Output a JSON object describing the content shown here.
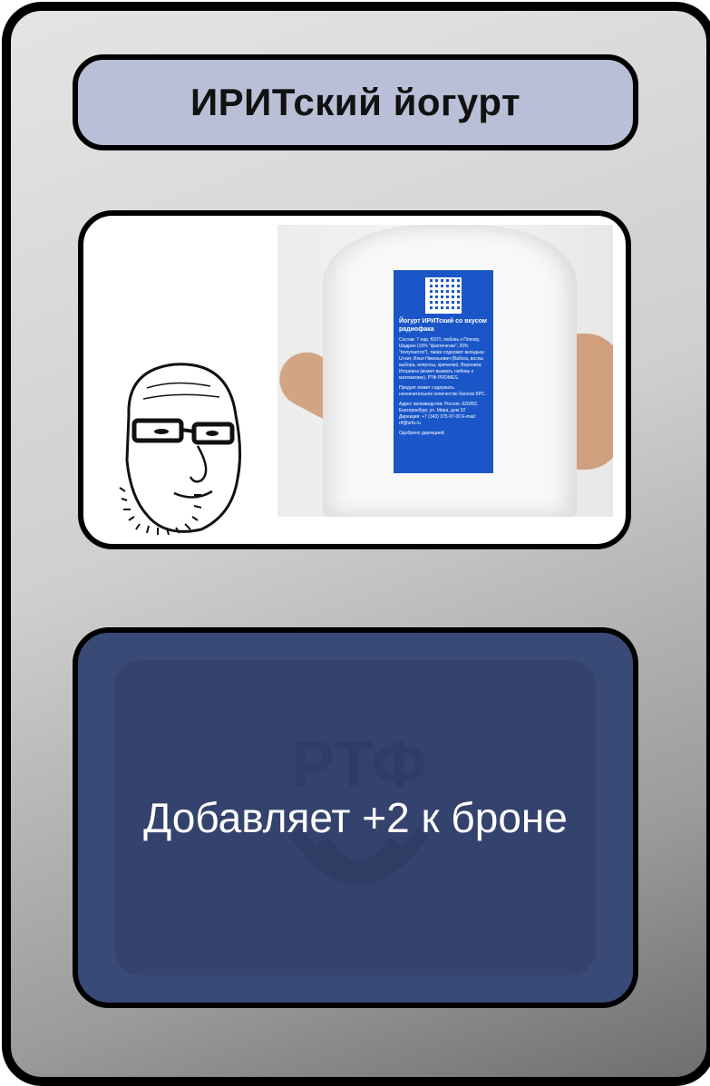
{
  "card": {
    "title": "ИРИТский йогурт",
    "effect": "Добавляет +2 к броне"
  },
  "shirt_label": {
    "heading": "Йогурт ИРИТский со вкусом радиофака",
    "composition": "Состав: 7 пар, ЮОТ, любовь к Попову, Шадрин (10% \"фактически\", 20% \"получается\"), также содержит вкладыш: Ui-кит, Илья Никоньевич (Вабога, воспы выбора, вопросы, кричалки), Вероника Игоревна (может вызвать любовь к математике), РТФ PROMES.",
    "note": "Продукт может содержать незначительное количество баллов БРС.",
    "address": "Адрес производства: Россия, 620002, Екатеринбург, ул. Мира, дом 32 Дирекция: +7 (343) 375-97-00 E-mail: rtf@urfu.ru",
    "approved": "Одобрено дирекцией."
  },
  "watermark": "РТФ",
  "colors": {
    "title_bg": "#b9bfd6",
    "effect_bg": "#3a4a77",
    "label_blue": "#1a56c8"
  }
}
